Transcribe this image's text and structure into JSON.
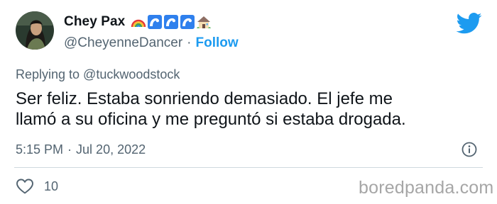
{
  "author": {
    "display_name": "Chey Pax",
    "handle": "@CheyenneDancer",
    "separator": "·",
    "follow_label": "Follow",
    "name_emojis": [
      "rainbow-emoji",
      "wave-emoji",
      "wave-emoji",
      "wave-emoji",
      "house-emoji"
    ]
  },
  "tweet": {
    "replying_to": "Replying to @tuckwoodstock",
    "text": "Ser feliz. Estaba sonriendo demasiado. El jefe me\nllamó a su oficina y me preguntó si estaba drogada.",
    "time": "5:15 PM",
    "date": "Jul 20, 2022",
    "separator": "·"
  },
  "engagement": {
    "like_count": "10"
  },
  "watermark": "boredpanda.com",
  "colors": {
    "accent": "#1d9bf0",
    "secondary_text": "#536471",
    "primary_text": "#0f1419",
    "divider": "#cfd9de",
    "watermark": "#a6a6a6"
  },
  "icons": {
    "brand": "twitter-bird-icon",
    "info": "info-icon",
    "like": "heart-icon"
  }
}
